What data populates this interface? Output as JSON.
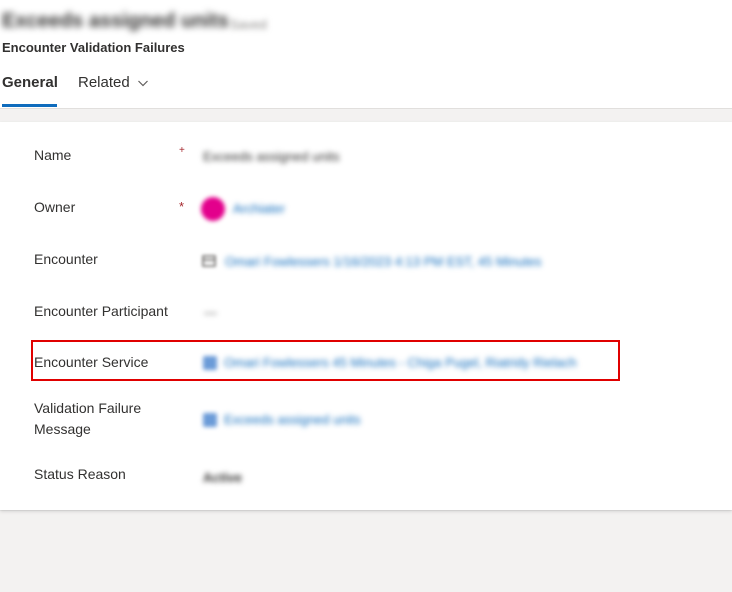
{
  "header": {
    "record_title": "Exceeds assigned units",
    "record_title_suffix": "- Saved",
    "entity_name": "Encounter Validation Failures"
  },
  "tabs": {
    "general": "General",
    "related": "Related"
  },
  "fields": {
    "name": {
      "label": "Name",
      "required_marker": "+",
      "value": "Exceeds assigned units"
    },
    "owner": {
      "label": "Owner",
      "required_marker": "*",
      "value": "Archiater"
    },
    "encounter": {
      "label": "Encounter",
      "value": "Omari Fowlessers 1/16/2023 4:13 PM EST, 45 Minutes"
    },
    "encounter_participant": {
      "label": "Encounter Participant",
      "value": "---"
    },
    "encounter_service": {
      "label": "Encounter Service",
      "value": "Omari Fowlessers 45 Minutes - Chiga Pugel, Riatridy Rielach"
    },
    "validation_failure_message": {
      "label": "Validation Failure Message",
      "value": "Exceeds assigned units"
    },
    "status_reason": {
      "label": "Status Reason",
      "value": "Active"
    }
  },
  "colors": {
    "accent": "#0f6cbd",
    "highlight": "#e00000",
    "required": "#a4262c",
    "avatar": "#e3008c"
  }
}
